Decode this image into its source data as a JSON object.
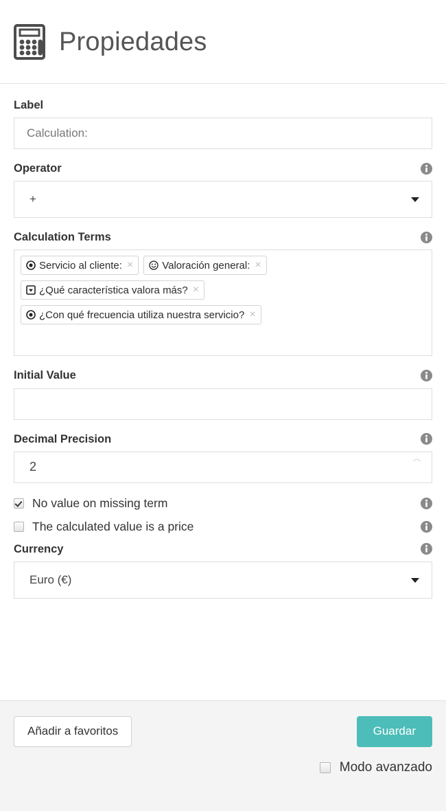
{
  "header": {
    "icon": "calculator-icon",
    "title": "Propiedades"
  },
  "form": {
    "label_field": {
      "label": "Label",
      "value": "Calculation:",
      "placeholder": "Calculation:"
    },
    "operator_field": {
      "label": "Operator",
      "value": "+",
      "info_icon": "info-icon",
      "caret_icon": "chevron-down-icon"
    },
    "calculation_terms": {
      "label": "Calculation Terms",
      "info_icon": "info-icon",
      "remove_glyph": "×",
      "tags": [
        {
          "icon": "radio-button-icon",
          "text": "Servicio al cliente:"
        },
        {
          "icon": "smiley-face-icon",
          "text": "Valoración general:"
        },
        {
          "icon": "dropdown-select-icon",
          "text": "¿Qué característica valora más?"
        },
        {
          "icon": "radio-button-icon",
          "text": "¿Con qué frecuencia utiliza nuestra servicio?"
        }
      ]
    },
    "initial_value": {
      "label": "Initial Value",
      "value": "",
      "info_icon": "info-icon"
    },
    "decimal_precision": {
      "label": "Decimal Precision",
      "value": "2",
      "info_icon": "info-icon",
      "spinner_icon": "spinner-up-icon"
    },
    "checkbox_no_value": {
      "label": "No value on missing term",
      "checked": true,
      "info_icon": "info-icon"
    },
    "checkbox_is_price": {
      "label": "The calculated value is a price",
      "checked": false,
      "info_icon": "info-icon"
    },
    "currency_field": {
      "label": "Currency",
      "value": "Euro (€)",
      "info_icon": "info-icon",
      "caret_icon": "chevron-down-icon"
    }
  },
  "footer": {
    "favorite_button": "Añadir a favoritos",
    "save_button": "Guardar",
    "advanced_mode": {
      "label": "Modo avanzado",
      "checked": false
    }
  },
  "colors": {
    "accent": "#4cbdb8",
    "border": "#dddddd",
    "footer_bg": "#f4f4f4",
    "text": "#333333",
    "muted_text": "#777777"
  }
}
